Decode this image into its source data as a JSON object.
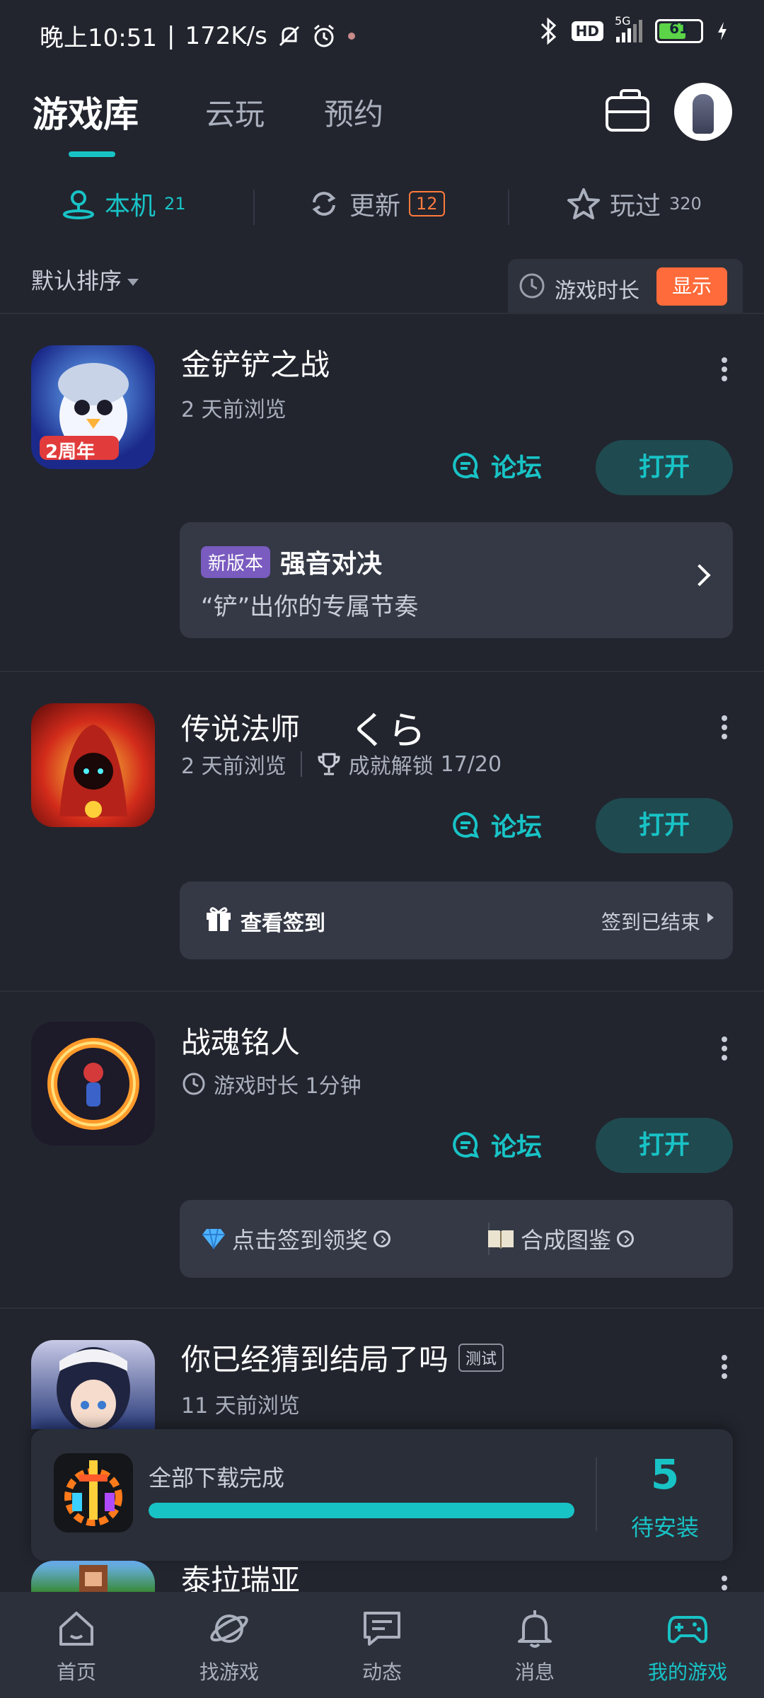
{
  "status_bar": {
    "time": "晚上10:51",
    "separator": "|",
    "net_speed": "172K/s",
    "hd_label": "HD",
    "network": "5G",
    "battery": "61"
  },
  "top_nav": {
    "tabs": [
      {
        "label": "游戏库",
        "active": true
      },
      {
        "label": "云玩",
        "active": false
      },
      {
        "label": "预约",
        "active": false
      }
    ]
  },
  "segments": [
    {
      "label": "本机",
      "count": "21",
      "active": true
    },
    {
      "label": "更新",
      "count": "12",
      "active": false
    },
    {
      "label": "玩过",
      "count": "320",
      "active": false
    }
  ],
  "sort": {
    "label": "默认排序",
    "playtime_label": "游戏时长",
    "show_button": "显示"
  },
  "games": [
    {
      "title": "金铲铲之战",
      "subtitle": "2 天前浏览",
      "icon_badge": "2周年",
      "forum": "论坛",
      "open": "打开",
      "panel": {
        "tag": "新版本",
        "title": "强音对决",
        "desc": "“铲”出你的专属节奏"
      }
    },
    {
      "title": "传说法师",
      "title_extra": "くら",
      "subtitle": "2 天前浏览",
      "achievement_label": "成就解锁",
      "achievement_value": "17/20",
      "forum": "论坛",
      "open": "打开",
      "panel": {
        "left": "查看签到",
        "right": "签到已结束"
      }
    },
    {
      "title": "战魂铭人",
      "subtitle": "游戏时长 1分钟",
      "forum": "论坛",
      "open": "打开",
      "panel": {
        "left": "点击签到领奖",
        "right": "合成图鉴"
      }
    },
    {
      "title": "你已经猜到结局了吗",
      "tag": "测试",
      "subtitle": "11 天前浏览"
    },
    {
      "title": "泰拉瑞亚"
    }
  ],
  "download": {
    "title": "全部下载完成",
    "progress": 1.0,
    "count": "5",
    "pending_label": "待安装"
  },
  "bottom_nav": [
    {
      "label": "首页",
      "icon": "home-icon",
      "active": false
    },
    {
      "label": "找游戏",
      "icon": "planet-icon",
      "active": false
    },
    {
      "label": "动态",
      "icon": "chat-icon",
      "active": false
    },
    {
      "label": "消息",
      "icon": "bell-icon",
      "active": false
    },
    {
      "label": "我的游戏",
      "icon": "gamepad-icon",
      "active": true
    }
  ],
  "colors": {
    "accent": "#18c3c6",
    "orange": "#ff6b3a",
    "background": "#22252e",
    "panel": "#343945"
  }
}
